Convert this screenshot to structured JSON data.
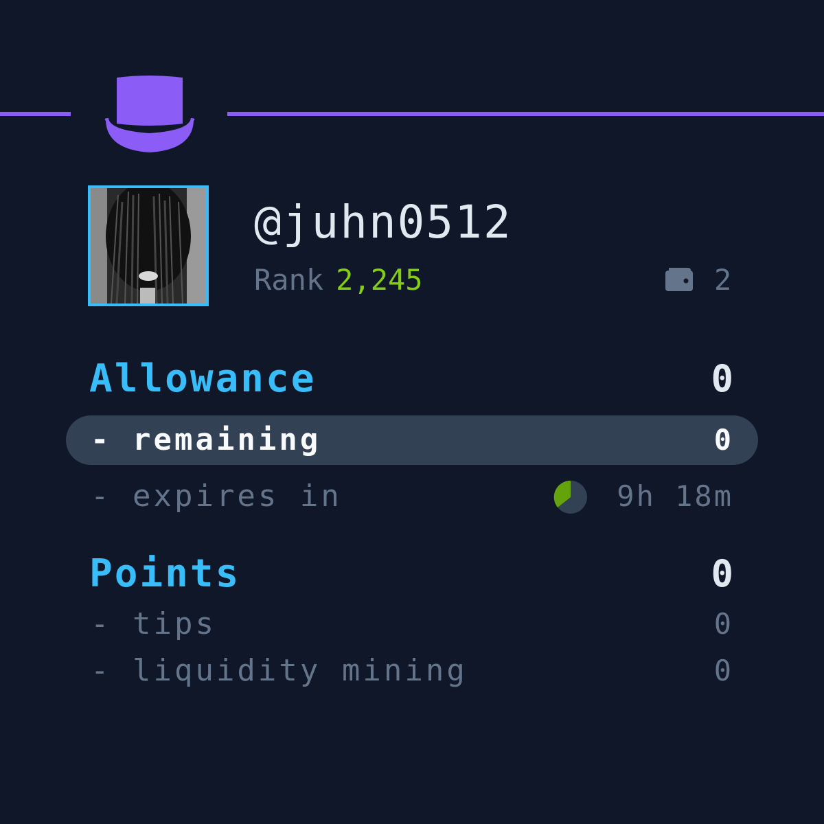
{
  "header": {
    "logo_icon": "top-hat-icon",
    "accent_color": "#8b5cf6"
  },
  "profile": {
    "avatar_icon": "user-avatar",
    "username": "@juhn0512",
    "rank_label": "Rank",
    "rank_value": "2,245",
    "wallet_icon": "wallet-icon",
    "wallet_count": "2"
  },
  "allowance": {
    "title": "Allowance",
    "total": "0",
    "remaining_label": "- remaining",
    "remaining_value": "0",
    "expires_label": "- expires in",
    "expires_icon": "pie-progress-icon",
    "expires_value": "9h 18m"
  },
  "points": {
    "title": "Points",
    "total": "0",
    "tips_label": "- tips",
    "tips_value": "0",
    "liquidity_label": "- liquidity mining",
    "liquidity_value": "0"
  },
  "colors": {
    "background": "#0f1729",
    "title": "#38bdf8",
    "rank": "#84cc16",
    "muted": "#64748b",
    "highlight": "#334155"
  }
}
